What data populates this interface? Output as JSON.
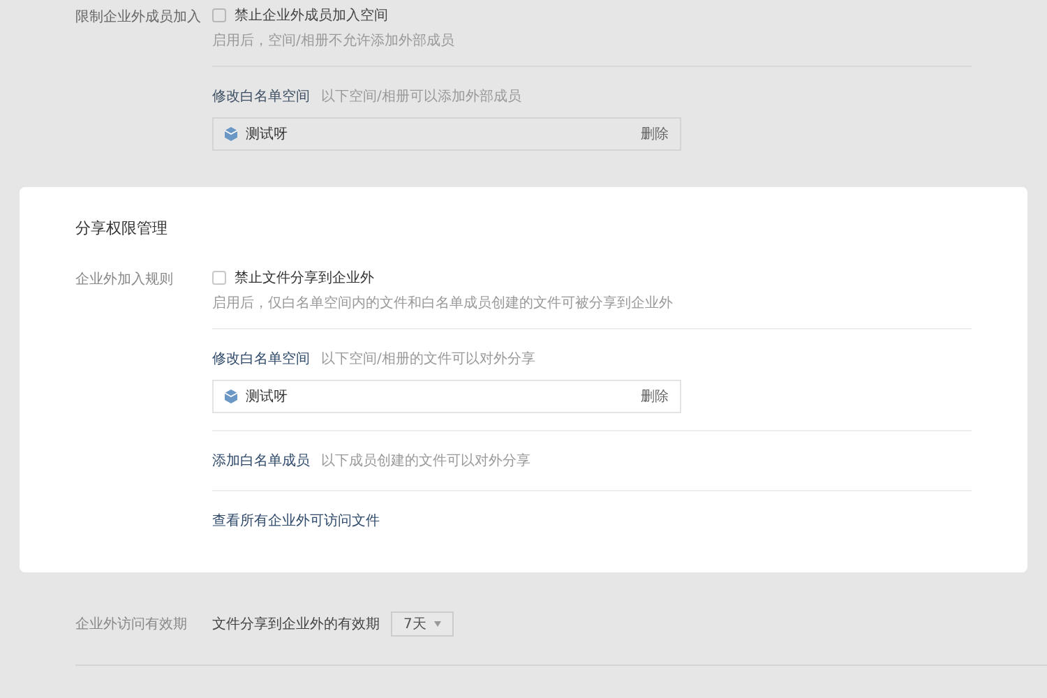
{
  "restrict_section": {
    "label": "限制企业外成员加入",
    "checkbox": {
      "label": "禁止企业外成员加入空间",
      "checked": false
    },
    "hint": "启用后，空间/相册不允许添加外部成员",
    "whitelist": {
      "link": "修改白名单空间",
      "hint": "以下空间/相册可以添加外部成员",
      "items": [
        {
          "name": "测试呀",
          "action": "删除"
        }
      ]
    }
  },
  "share_section": {
    "title": "分享权限管理",
    "label": "企业外加入规则",
    "checkbox": {
      "label": "禁止文件分享到企业外",
      "checked": false
    },
    "hint": "启用后，仅白名单空间内的文件和白名单成员创建的文件可被分享到企业外",
    "whitelist": {
      "link": "修改白名单空间",
      "hint": "以下空间/相册的文件可以对外分享",
      "items": [
        {
          "name": "测试呀",
          "action": "删除"
        }
      ]
    },
    "members": {
      "link": "添加白名单成员",
      "hint": "以下成员创建的文件可以对外分享"
    },
    "view_all_link": "查看所有企业外可访问文件"
  },
  "validity": {
    "label": "企业外访问有效期",
    "text": "文件分享到企业外的有效期",
    "select": {
      "value": "7天"
    }
  }
}
